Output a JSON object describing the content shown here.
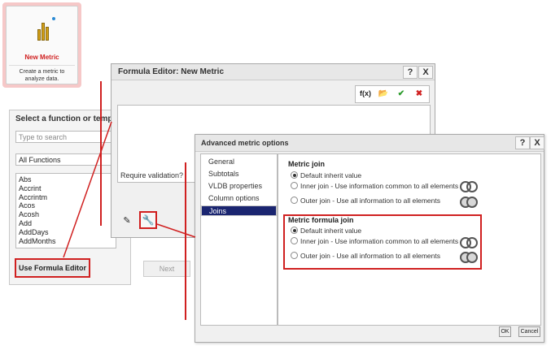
{
  "tile": {
    "title": "New Metric",
    "description": "Create a metric to analyze data."
  },
  "select_dialog": {
    "title": "Select a function or templa",
    "search_placeholder": "Type to search",
    "category": "All Functions",
    "functions": [
      "Abs",
      "Accrint",
      "Accrintm",
      "Acos",
      "Acosh",
      "Add",
      "AddDays",
      "AddMonths"
    ],
    "use_formula_editor": "Use Formula Editor",
    "next": "Next"
  },
  "formula_editor": {
    "title": "Formula Editor: New Metric",
    "help": "?",
    "close": "X",
    "fx_label": "f(x)",
    "require_validation": "Require validation?"
  },
  "advanced": {
    "title": "Advanced metric options",
    "help": "?",
    "close": "X",
    "nav": [
      "General",
      "Subtotals",
      "VLDB properties",
      "Column options",
      "Joins"
    ],
    "selected_nav": "Joins",
    "metric_join": {
      "label": "Metric join",
      "default": "Default inherit value",
      "inner": "Inner join - Use information common to all elements",
      "outer": "Outer join - Use all information to all elements"
    },
    "metric_formula_join": {
      "label": "Metric formula join",
      "default": "Default inherit value",
      "inner": "Inner join - Use information common to all elements",
      "outer": "Outer join - Use all information to all elements"
    },
    "ok": "OK",
    "cancel": "Cancel"
  },
  "colors": {
    "highlight": "#d02020",
    "nav_selected": "#1a2570",
    "tile_title": "#d02020"
  }
}
